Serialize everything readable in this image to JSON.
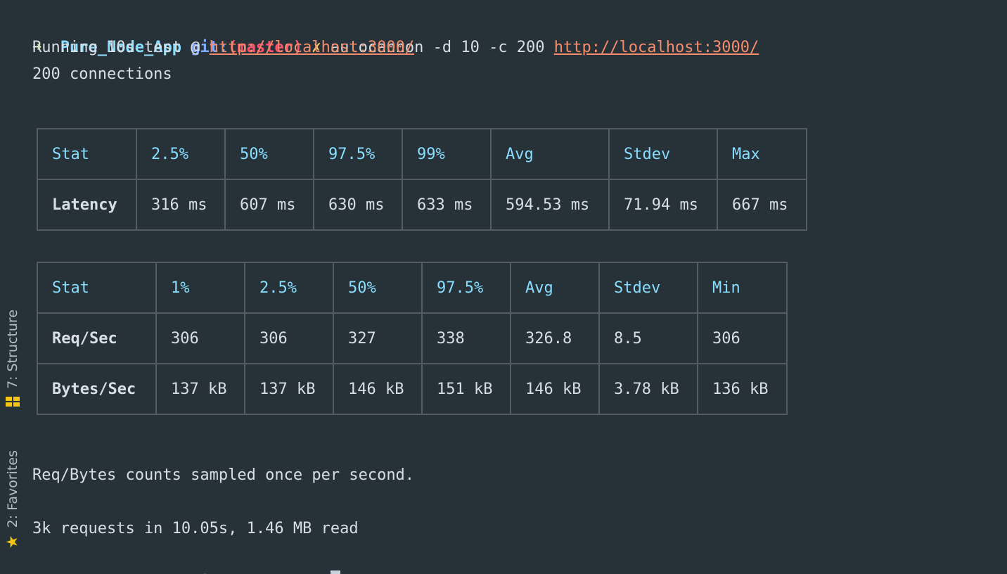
{
  "prompt": {
    "arrow": "➜",
    "directory": "Pure_Node_App",
    "git_label": "git:",
    "open_paren": "(",
    "branch": "master",
    "close_paren": ")",
    "dirty_mark": "✗"
  },
  "command": {
    "text": "autocannon -d 10 -c 200",
    "url": "http://localhost:3000/"
  },
  "output": {
    "running_prefix": "Running 10s test @",
    "running_url": "http://localhost:3000/",
    "connections": "200 connections",
    "sampled_note": "Req/Bytes counts sampled once per second.",
    "summary": "3k requests in 10.05s, 1.46 MB read"
  },
  "latency_table": {
    "headers": [
      "Stat",
      "2.5%",
      "50%",
      "97.5%",
      "99%",
      "Avg",
      "Stdev",
      "Max"
    ],
    "rows": [
      [
        "Latency",
        "316 ms",
        "607 ms",
        "630 ms",
        "633 ms",
        "594.53 ms",
        "71.94 ms",
        "667 ms"
      ]
    ]
  },
  "throughput_table": {
    "headers": [
      "Stat",
      "1%",
      "2.5%",
      "50%",
      "97.5%",
      "Avg",
      "Stdev",
      "Min"
    ],
    "rows": [
      [
        "Req/Sec",
        "306",
        "306",
        "327",
        "338",
        "326.8",
        "8.5",
        "306"
      ],
      [
        "Bytes/Sec",
        "137 kB",
        "137 kB",
        "146 kB",
        "151 kB",
        "146 kB",
        "3.78 kB",
        "136 kB"
      ]
    ]
  },
  "sidebar": {
    "structure_label": "7: Structure",
    "favorites_label": "2: Favorites",
    "structure_icon": "structure-icon",
    "favorites_icon": "star-icon"
  },
  "colors": {
    "background": "#263238",
    "accent_yellow": "#f5c518",
    "header_cyan": "#89ddff",
    "branch_red": "#ff5370",
    "url_orange": "#f78c6c"
  }
}
